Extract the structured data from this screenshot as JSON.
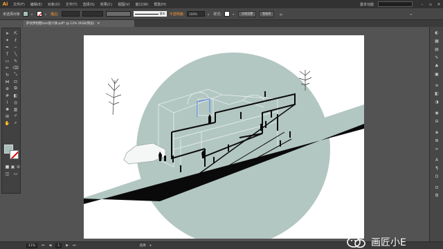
{
  "app": {
    "logo": "Ai",
    "workspace": "基本功能",
    "window_controls": [
      "–",
      "▫",
      "✕"
    ]
  },
  "menu": [
    "文件(F)",
    "编辑(E)",
    "对象(O)",
    "文字(T)",
    "选择(S)",
    "效果(C)",
    "视图(V)",
    "窗口(W)",
    "帮助(H)"
  ],
  "control": {
    "selection_label": "未选择对象",
    "stroke_label": "描边:",
    "stroke_profile": "基本",
    "opacity_label": "不透明度:",
    "opacity_value": "100%",
    "style_label": "样式:",
    "document_setup": "文档设置",
    "preferences": "首选项",
    "fill_color": "#a7bfba",
    "accent_color": "#f79833"
  },
  "document": {
    "tab_title": "萨伏伊别墅tam第六弹.pdf* @ 12% (RGB/预览)",
    "close": "✕"
  },
  "status": {
    "zoom": "11%",
    "page": "1",
    "tool": "选择"
  },
  "watermark": {
    "text": "画匠小E"
  },
  "illustration": {
    "circle_color": "#b3c7c2",
    "ground_color": "#b3c7c2"
  }
}
